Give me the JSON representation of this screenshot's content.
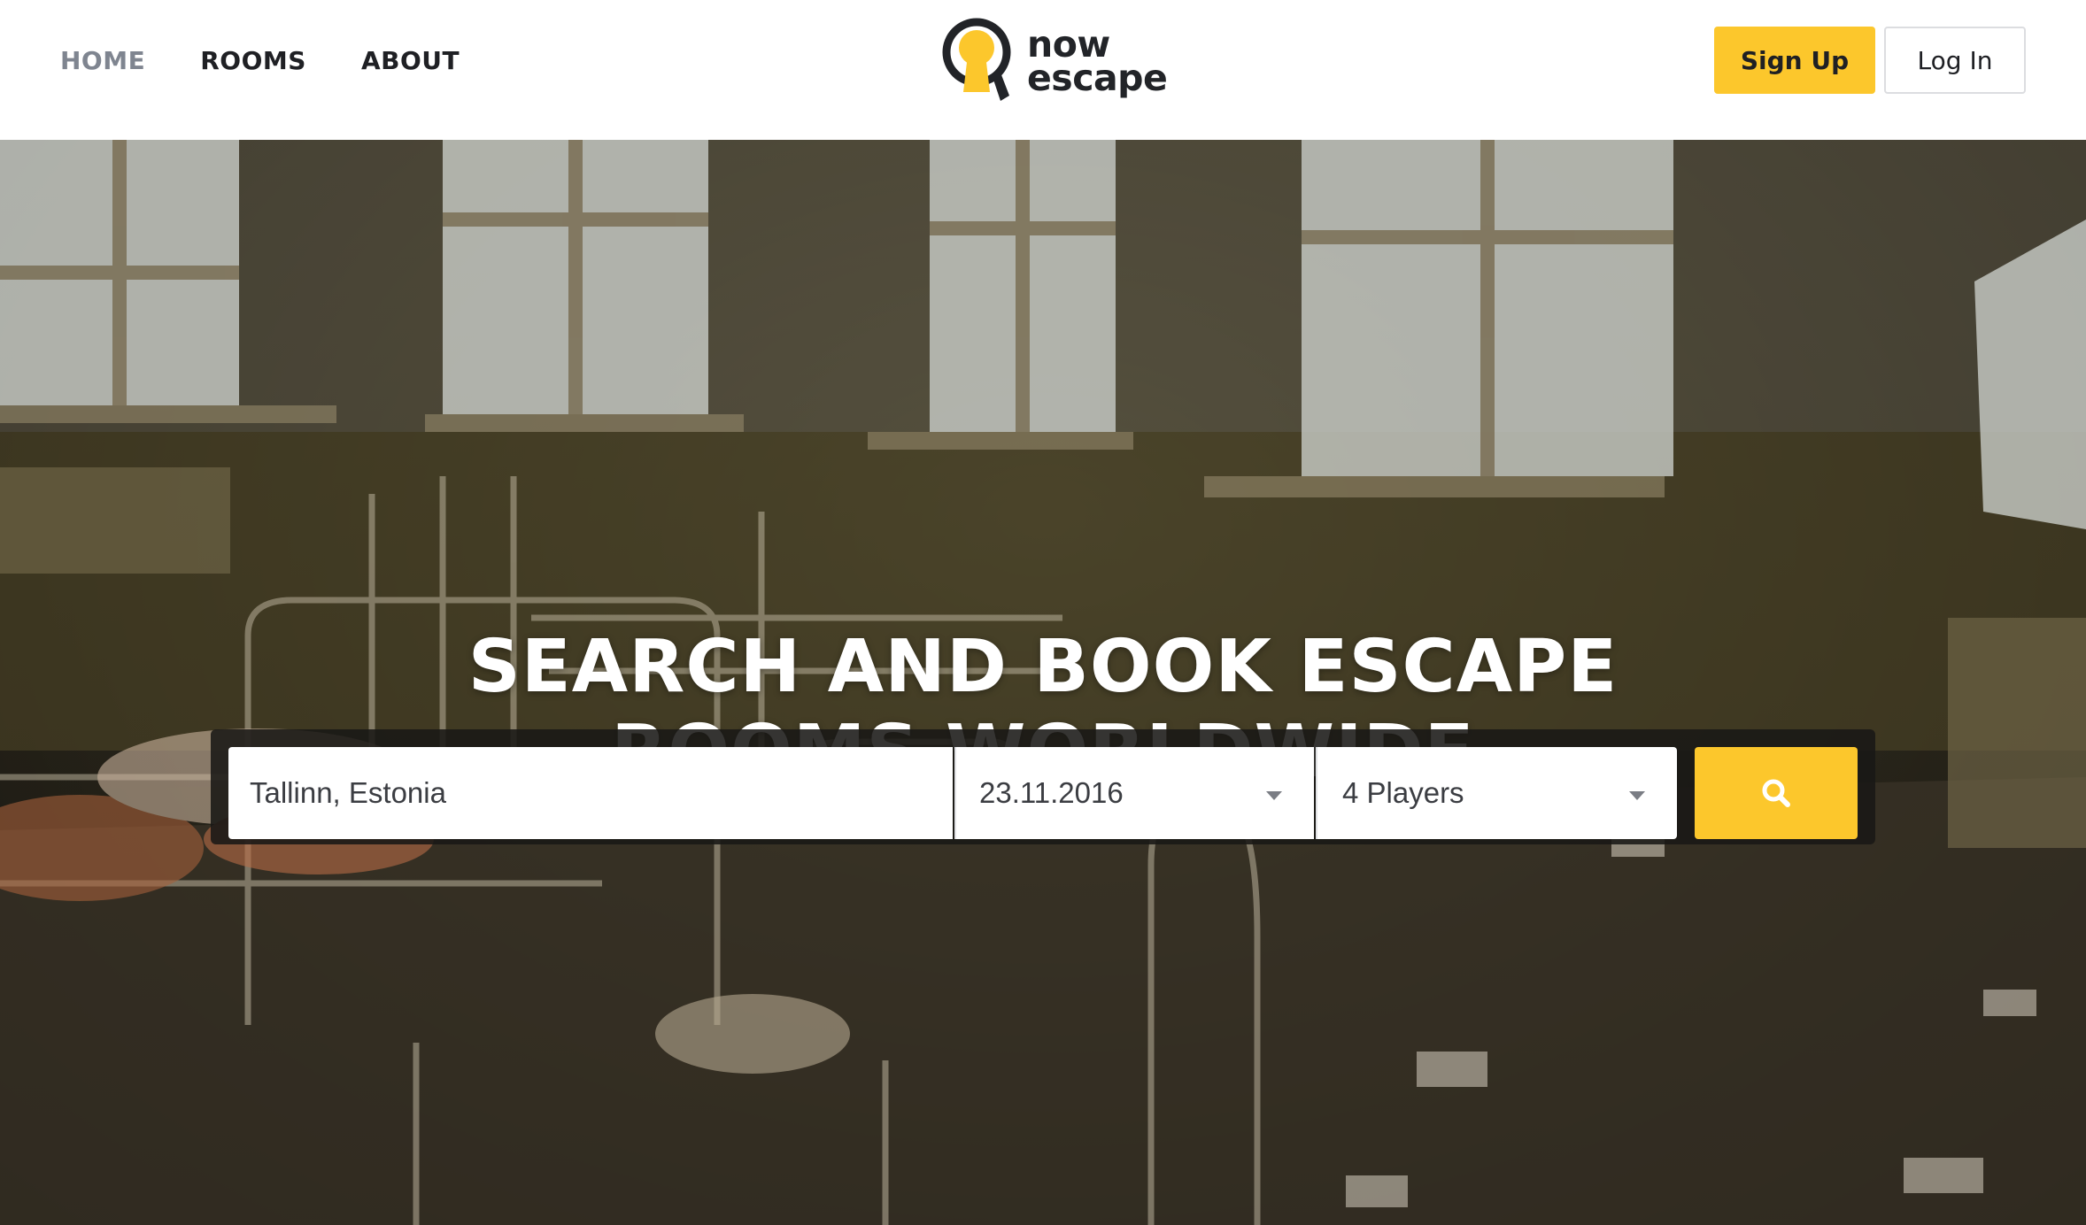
{
  "nav": {
    "items": [
      {
        "label": "HOME",
        "active": true
      },
      {
        "label": "ROOMS",
        "active": false
      },
      {
        "label": "ABOUT",
        "active": false
      }
    ]
  },
  "logo": {
    "line1": "now",
    "line2": "escape"
  },
  "auth": {
    "signup_label": "Sign Up",
    "login_label": "Log In"
  },
  "hero": {
    "headline_line1": "SEARCH AND BOOK ESCAPE",
    "headline_line2": "ROOMS WORLDWIDE"
  },
  "search": {
    "location_value": "Tallinn, Estonia",
    "date_value": "23.11.2016",
    "players_value": "4 Players",
    "button_icon": "search-icon"
  },
  "colors": {
    "accent": "#fcc72c",
    "text_dark": "#1f2024",
    "nav_active": "#7f8590"
  }
}
